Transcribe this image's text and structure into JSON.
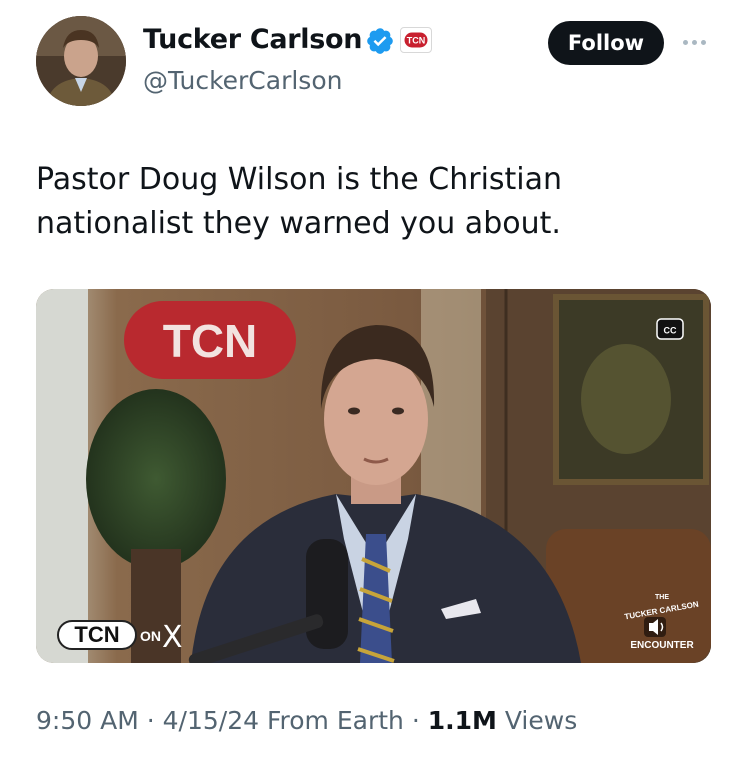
{
  "author": {
    "display_name": "Tucker Carlson",
    "handle": "@TuckerCarlson",
    "affiliate_badge_text": "TCN",
    "verified_color": "#1d9bf0"
  },
  "actions": {
    "follow_label": "Follow",
    "more_icon": "more-horizontal-icon"
  },
  "tweet": {
    "text": "Pastor Doug Wilson is the Christian nationalist they warned you about."
  },
  "media": {
    "wall_sign": "TCN",
    "cc_label": "CC",
    "watermark_left": "TCN",
    "watermark_on": "ON",
    "watermark_x": "X",
    "watermark_right_top": "THE",
    "watermark_right_arc": "TUCKER CARLSON",
    "watermark_right_bottom": "ENCOUNTER"
  },
  "meta": {
    "time": "9:50 AM",
    "date": "4/15/24",
    "source": "From Earth",
    "views_count": "1.1M",
    "views_label": "Views",
    "separator": "·"
  }
}
